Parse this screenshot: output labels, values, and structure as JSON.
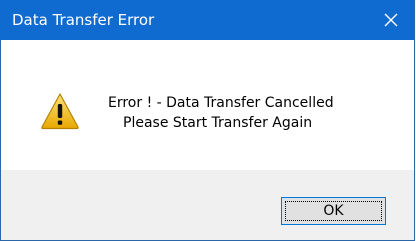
{
  "window": {
    "title": "Data Transfer Error",
    "close_glyph": "✕"
  },
  "message": {
    "line1": "Error ! - Data Transfer Cancelled",
    "line2": "Please Start Transfer Again",
    "icon": "warning-icon"
  },
  "buttons": {
    "ok_label": "OK"
  },
  "colors": {
    "titlebar": "#0f6bd0",
    "footer": "#f0f0f0",
    "button_border": "#0078d7",
    "warning_yellow": "#f4c430"
  }
}
